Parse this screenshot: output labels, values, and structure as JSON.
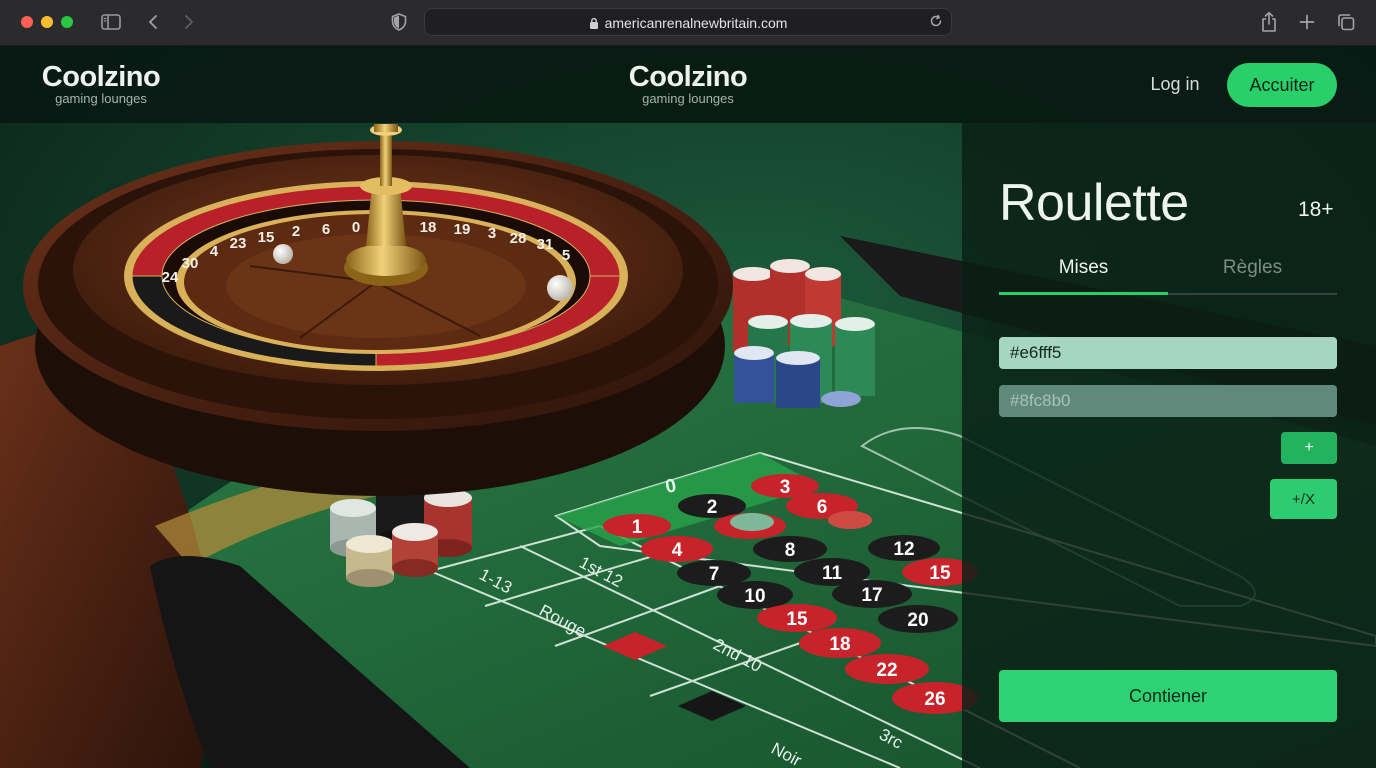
{
  "browser": {
    "url": "americanrenalnewbritain.com",
    "icons": [
      "sidebar-icon",
      "back-icon",
      "forward-icon",
      "shield-icon",
      "lock-icon",
      "reload-icon",
      "share-icon",
      "new-tab-icon",
      "tabs-icon"
    ]
  },
  "header": {
    "logo_left": {
      "name": "Coolzino",
      "tagline": "gaming lounges"
    },
    "logo_center": {
      "name": "Coolzino",
      "tagline": "gaming lounges"
    },
    "login_label": "Log in",
    "accept_label": "Accuiter"
  },
  "panel": {
    "title": "Roulette",
    "age_badge": "18+",
    "tabs": [
      {
        "label": "Mises",
        "active": true
      },
      {
        "label": "Règles",
        "active": false
      }
    ],
    "field_a_value": "#e6fff5",
    "field_b_placeholder": "#8fc8b0",
    "plus_label": "+",
    "plusx_label": "+/X",
    "contain_label": "Contiener"
  },
  "scene": {
    "wheel_numbers": [
      "15",
      "6",
      "0",
      "18",
      "19",
      "3",
      "28",
      "31",
      "5",
      "23",
      "4",
      "30",
      "24",
      "2"
    ],
    "table_zero": "0",
    "table_numbers": [
      "1",
      "2",
      "3",
      "4",
      "6",
      "7",
      "8",
      "10",
      "11",
      "12",
      "15",
      "15",
      "17",
      "18",
      "20",
      "22",
      "26"
    ],
    "table_labels": [
      "1-13",
      "1st 12",
      "Rouge",
      "2nd 10",
      "3rc",
      "Noir"
    ]
  },
  "colors": {
    "accent": "#29d06a",
    "felt": "#1f6b3c",
    "wood": "#4a2113",
    "panel": "#0a1e16",
    "red": "#c8222b",
    "black": "#1c1c1c"
  }
}
